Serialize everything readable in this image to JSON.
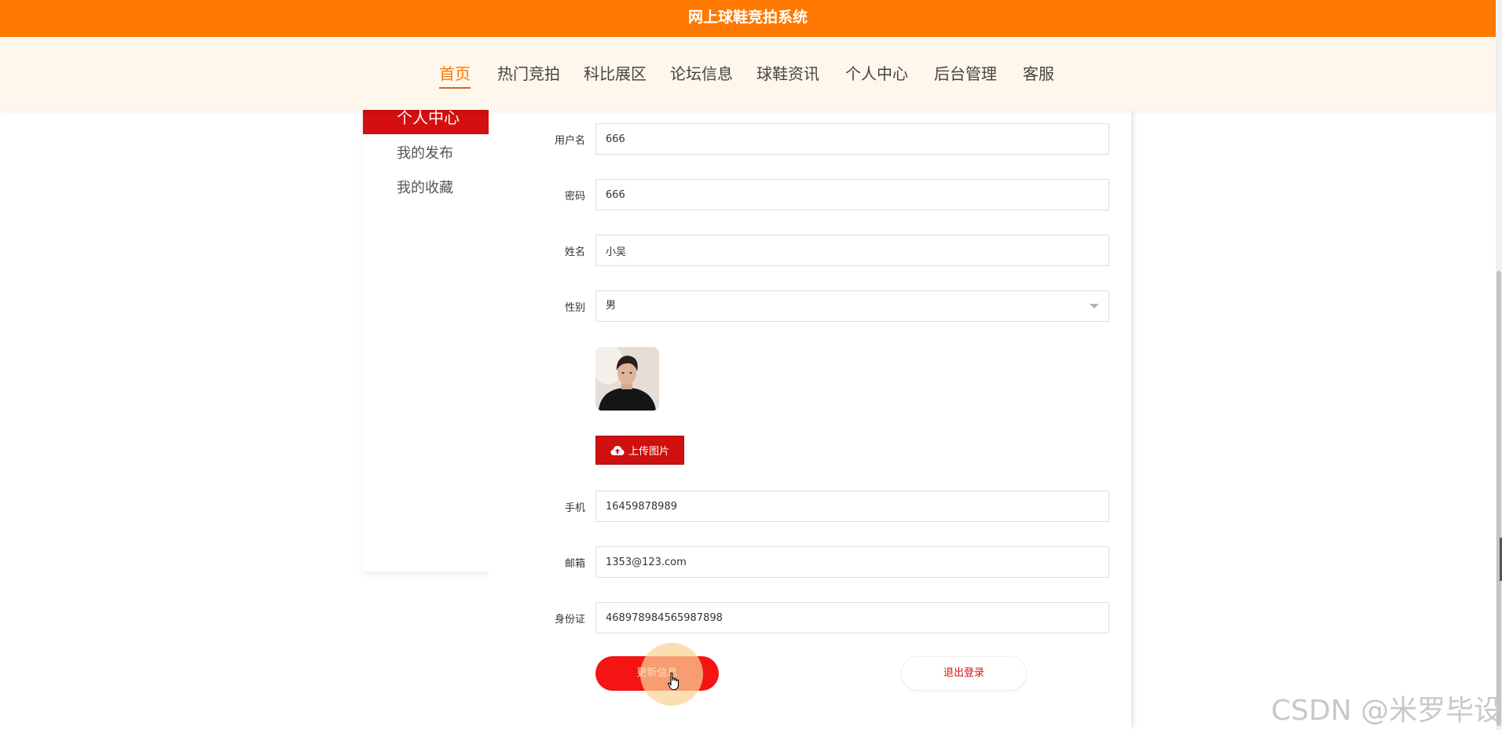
{
  "site": {
    "title": "网上球鞋竞拍系统"
  },
  "nav": {
    "items": [
      {
        "label": "首页",
        "active": true
      },
      {
        "label": "热门竞拍"
      },
      {
        "label": "科比展区"
      },
      {
        "label": "论坛信息"
      },
      {
        "label": "球鞋资讯"
      },
      {
        "label": "个人中心"
      },
      {
        "label": "后台管理"
      },
      {
        "label": "客服"
      }
    ]
  },
  "sidebar": {
    "items": [
      {
        "label": "个人中心",
        "active": true
      },
      {
        "label": "我的发布"
      },
      {
        "label": "我的收藏"
      }
    ]
  },
  "form": {
    "username": {
      "label": "用户名",
      "value": "666"
    },
    "password": {
      "label": "密码",
      "value": "666"
    },
    "name": {
      "label": "姓名",
      "value": "小吴"
    },
    "gender": {
      "label": "性别",
      "value": "男"
    },
    "upload_label": "上传图片",
    "phone": {
      "label": "手机",
      "value": "16459878989"
    },
    "email": {
      "label": "邮箱",
      "value": "1353@123.com"
    },
    "id_card": {
      "label": "身份证",
      "value": "468978984565987898"
    }
  },
  "actions": {
    "update_label": "更新信息",
    "logout_label": "退出登录"
  },
  "watermark": "CSDN @米罗毕设",
  "colors": {
    "topbar": "#ff7800",
    "accent_red": "#d40f0f",
    "nav_bg": "#fff6ec"
  }
}
